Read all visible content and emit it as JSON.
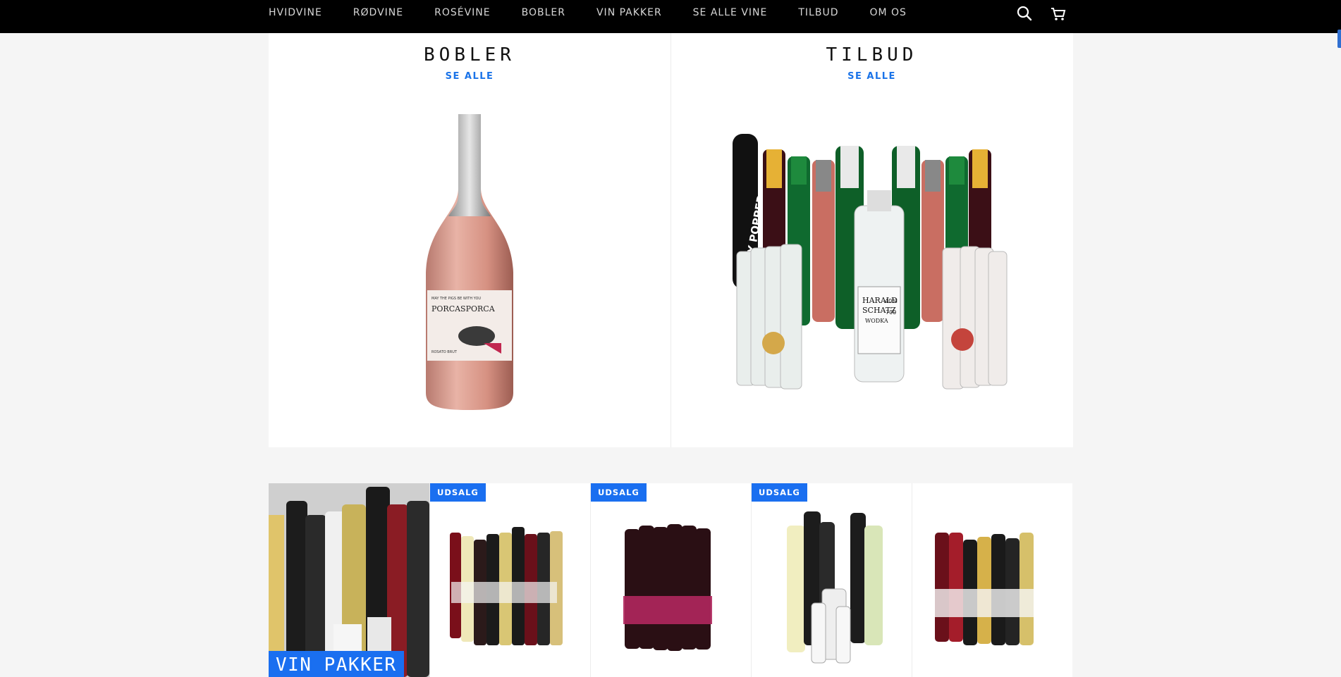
{
  "nav": {
    "items": [
      "HVIDVINE",
      "RØDVINE",
      "ROSÉVINE",
      "BOBLER",
      "VIN PAKKER",
      "SE ALLE VINE",
      "TILBUD",
      "OM OS"
    ]
  },
  "header": {
    "search_icon": "search-icon",
    "cart_icon": "cart-icon"
  },
  "features": [
    {
      "title": "BOBLER",
      "link": "SE ALLE",
      "label_top": "MAY THE PIGS BE WITH YOU",
      "label_name": "PORCASPORCA",
      "label_sub": "ROSATO BRUT"
    },
    {
      "title": "TILBUD",
      "link": "SE ALLE",
      "banner": "PARTY POPPER SILVER",
      "bottle_text_1": "HARALD",
      "bottle_text_2": "SCHATZ",
      "bottle_text_3": "WODKA",
      "bottle_abv": "40%",
      "bottle_vol": "700"
    }
  ],
  "products": [
    {
      "badge": "",
      "label": "VIN PAKKER"
    },
    {
      "badge": "UDSALG"
    },
    {
      "badge": "UDSALG"
    },
    {
      "badge": "UDSALG"
    },
    {
      "badge": ""
    }
  ],
  "colors": {
    "accent": "#1a6ff0",
    "link": "#1a73e8",
    "header_bg": "#000000"
  }
}
